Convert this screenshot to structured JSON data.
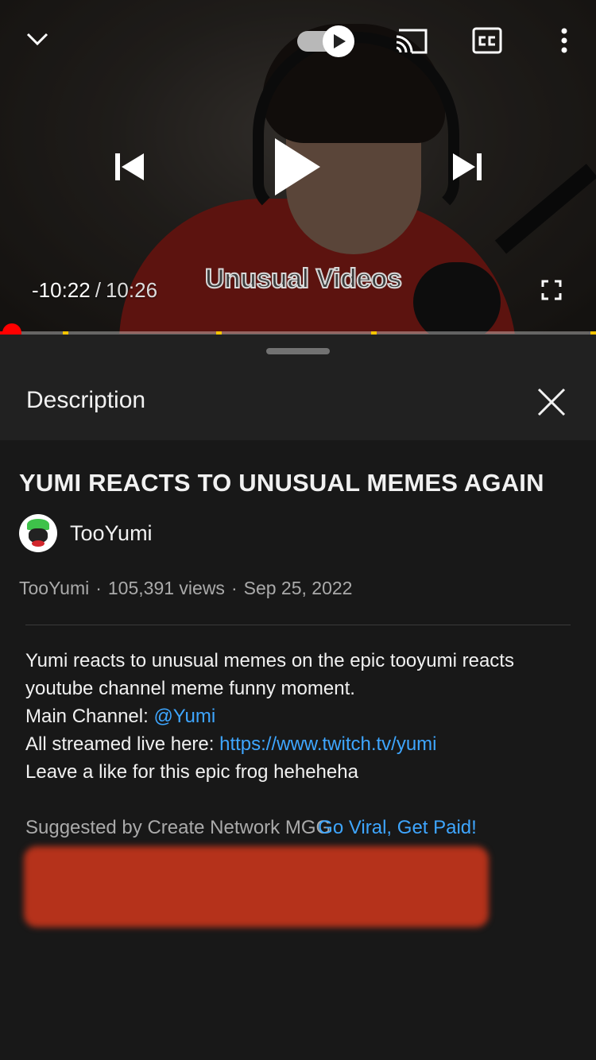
{
  "player": {
    "time_elapsed": "-10:22",
    "time_separator": "/",
    "time_total": "10:26",
    "watermark": "Unusual Videos",
    "progress_fraction": 0.02,
    "chapter_markers": [
      0.105,
      0.363,
      0.622,
      0.99
    ],
    "autoplay_on": true,
    "icons": [
      "chevron-down-icon",
      "autoplay-toggle-icon",
      "cast-icon",
      "cc-icon",
      "more-vert-icon",
      "skip-previous-icon",
      "play-icon",
      "skip-next-icon",
      "fullscreen-icon"
    ]
  },
  "sheet": {
    "title": "Description",
    "close_icon": "close-icon"
  },
  "video": {
    "title": "YUMI REACTS TO UNUSUAL MEMES AGAIN",
    "channel": "TooYumi",
    "meta_channel": "TooYumi",
    "views": "105,391 views",
    "date": "Sep 25, 2022"
  },
  "description": {
    "line1": "Yumi reacts to unusual memes on the epic tooyumi reacts",
    "line2": "youtube channel meme funny moment.",
    "main_channel_label": "Main Channel: ",
    "main_channel_link": "@Yumi",
    "streamed_label": "All streamed live here: ",
    "streamed_link": "https://www.twitch.tv/yumi",
    "line5": "Leave a like for this epic frog heheheha",
    "suggested_label": "Suggested by Create Network MGG",
    "suggested_link": "Go Viral, Get Paid!"
  },
  "colors": {
    "accent_red": "#ff0000",
    "link_blue": "#3ea6ff",
    "sheet_bg": "#181818",
    "header_bg": "#212121",
    "redaction": "#b5321b"
  }
}
